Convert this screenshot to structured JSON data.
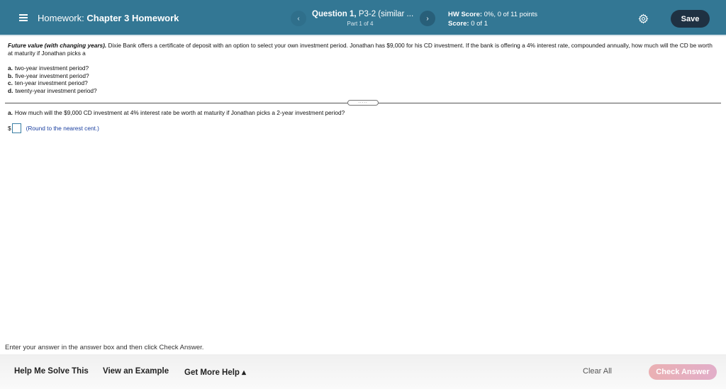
{
  "header": {
    "hw_prefix": "Homework:",
    "hw_name": "Chapter 3 Homework",
    "question_bold": "Question 1,",
    "question_rest": " P3-2 (similar ...",
    "part": "Part 1 of 4",
    "hw_score_label": "HW Score:",
    "hw_score_value": " 0%, 0 of 11 points",
    "score_label": "Score:",
    "score_value": " 0 of 1",
    "prev_icon": "‹",
    "next_icon": "›",
    "save_label": "Save",
    "colors": {
      "header_bg": "#337794",
      "save_bg": "#1f3142"
    }
  },
  "problem": {
    "title": "Future value (with changing years).",
    "text": "  Dixie Bank offers a certificate of deposit with an option to select your own investment period.  Jonathan has $9,000 for his CD investment.  If the bank is offering a 4% interest rate, compounded annually, how much will the CD be worth at maturity if Jonathan picks a",
    "parts": [
      {
        "letter": "a.",
        "text": "two-year investment period?"
      },
      {
        "letter": "b.",
        "text": "five-year investment period?"
      },
      {
        "letter": "c.",
        "text": "ten-year investment period?"
      },
      {
        "letter": "d.",
        "text": "twenty-year investment period?"
      }
    ]
  },
  "divider_handle": ".....",
  "sub_question": {
    "letter": "a.",
    "text": "How much will the $9,000 CD investment at 4% interest rate be worth at maturity if Jonathan picks a 2-year investment period?"
  },
  "answer": {
    "prefix": "$",
    "value": "",
    "hint": "(Round to the nearest cent.)"
  },
  "instructions": "Enter your answer in the answer box and then click Check Answer.",
  "footer": {
    "help_me_solve": "Help Me Solve This",
    "view_example": "View an Example",
    "get_more_help": "Get More Help ▴",
    "clear_all": "Clear All",
    "check_answer": "Check Answer"
  }
}
